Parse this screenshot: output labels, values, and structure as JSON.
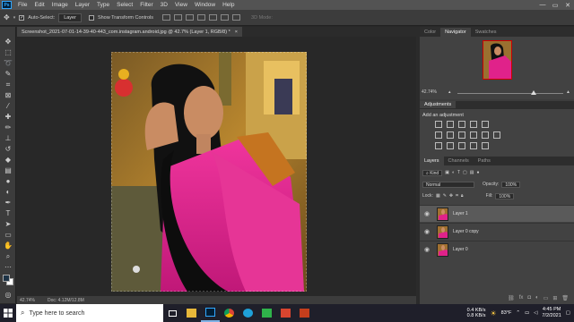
{
  "app": {
    "logo": "Ps"
  },
  "menu": [
    "File",
    "Edit",
    "Image",
    "Layer",
    "Type",
    "Select",
    "Filter",
    "3D",
    "View",
    "Window",
    "Help"
  ],
  "window_controls": {
    "minimize": "—",
    "restore": "▭",
    "close": "✕"
  },
  "options": {
    "auto_select_label": "Auto-Select:",
    "auto_select_value": "Layer",
    "transform_label": "Show Transform Controls",
    "mode_3d": "3D Mode:"
  },
  "document": {
    "tab_title": "Screenshot_2021-07-01-14-39-40-443_com.instagram.android.jpg @ 42.7% (Layer 1, RGB/8) *",
    "close": "×"
  },
  "status": {
    "zoom": "42.74%",
    "doc": "Doc: 4.12M/12.8M"
  },
  "panels": {
    "top_tabs": [
      "Color",
      "Navigator",
      "Swatches"
    ],
    "active_top_tab": "Navigator",
    "navigator_zoom": "42.74%",
    "navigator_zoom_fraction": 0.72,
    "adjustments_tab": "Adjustments",
    "add_adjustment": "Add an adjustment",
    "layer_tabs": [
      "Layers",
      "Channels",
      "Paths"
    ],
    "active_layer_tab": "Layers",
    "kind": "Kind",
    "blend_mode": "Normal",
    "opacity_label": "Opacity:",
    "opacity": "100%",
    "lock_label": "Lock:",
    "fill_label": "Fill:",
    "fill": "100%",
    "layers": [
      {
        "name": "Layer 1",
        "selected": true
      },
      {
        "name": "Layer 0 copy",
        "selected": false
      },
      {
        "name": "Layer 0",
        "selected": false
      }
    ]
  },
  "taskbar": {
    "search_placeholder": "Type here to search",
    "apps": [
      "task-view",
      "file-explorer",
      "photoshop",
      "chrome",
      "edge",
      "camtasia",
      "video-editor",
      "powerpoint"
    ],
    "net_up": "0.4 KB/s",
    "net_down": "0.8 KB/s",
    "temperature": "83°F",
    "time": "4:45 PM",
    "date": "7/2/2021"
  },
  "colors": {
    "accent": "#31a8ff",
    "foreground": "#1d3346",
    "background": "#ffffff",
    "saree": "#e0228a"
  }
}
